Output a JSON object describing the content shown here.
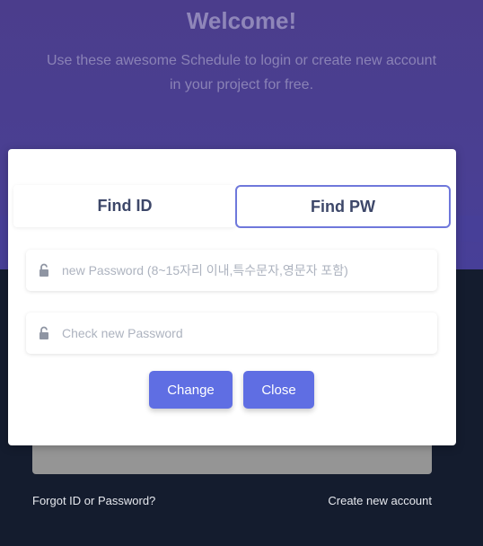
{
  "hero": {
    "title": "Welcome!",
    "subtitle_line1": "Use these awesome Schedule to login or create new account",
    "subtitle_line2": "in your project for free."
  },
  "modal": {
    "tabs": [
      {
        "label": "Find ID",
        "active": false
      },
      {
        "label": "Find PW",
        "active": true
      }
    ],
    "new_password": {
      "placeholder": "new Password (8~15자리 이내,특수문자,영문자 포함)",
      "value": "",
      "icon": "lock-icon"
    },
    "check_password": {
      "placeholder": "Check new Password",
      "value": "",
      "icon": "lock-icon"
    },
    "change_label": "Change",
    "close_label": "Close"
  },
  "footer": {
    "forgot_label": "Forgot ID or Password?",
    "create_label": "Create new account"
  },
  "colors": {
    "hero": "#4a3f92",
    "background": "#141c2e",
    "accent": "#5f6ee3"
  }
}
